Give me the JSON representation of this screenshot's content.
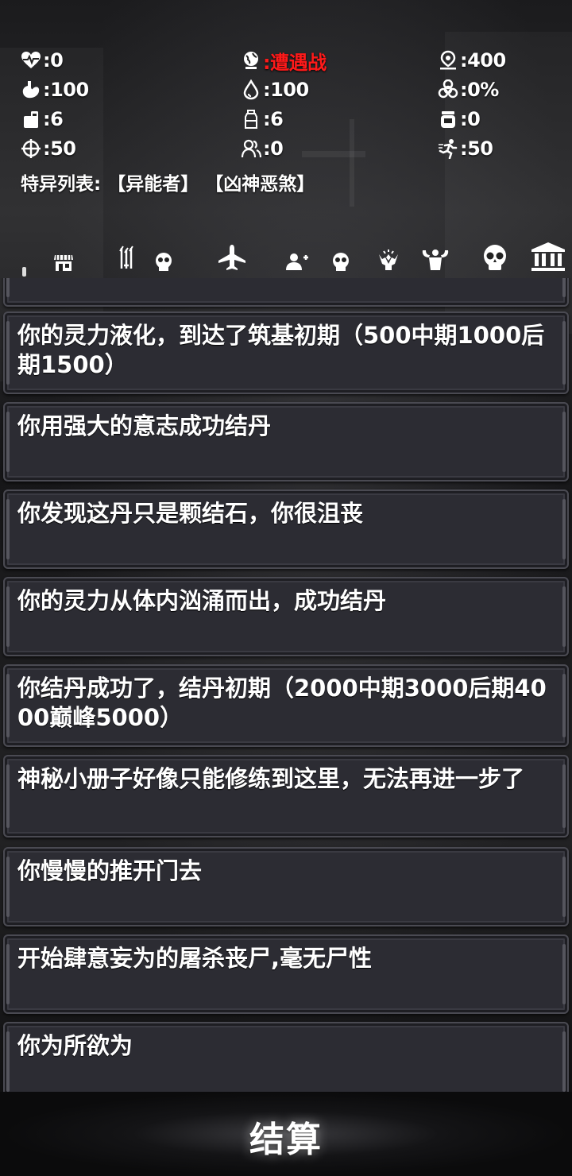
{
  "stats": {
    "health": ":0",
    "mode": ":遭遇战",
    "distance": ":400",
    "hunger": ":100",
    "water": ":100",
    "infection": ":0%",
    "food": ":6",
    "drink": ":6",
    "supplies": ":0",
    "accuracy": ":50",
    "companions": ":0",
    "agility": ":50"
  },
  "traits": {
    "label": "特异列表:",
    "items": [
      "【异能者】",
      "【凶神恶煞】"
    ]
  },
  "colors": {
    "mode_red": "#ff1a1a",
    "card_bg": "#2c2c33"
  },
  "toolbar": {
    "icons": [
      "shop-icon",
      "weapon-skull-icon",
      "plane-icon",
      "add-skull-icon",
      "relic-icon",
      "muscle-icon",
      "big-skull-icon",
      "bank-icon"
    ]
  },
  "log": [
    "",
    "你的灵力液化，到达了筑基初期（500中期1000后期1500）",
    "你用强大的意志成功结丹",
    "你发现这丹只是颗结石，你很沮丧",
    "你的灵力从体内汹涌而出，成功结丹",
    "你结丹成功了，结丹初期（2000中期3000后期4000巅峰5000）",
    "神秘小册子好像只能修练到这里，无法再进一步了",
    "你慢慢的推开门去",
    "开始肆意妄为的屠杀丧尸,毫无尸性",
    "你为所欲为"
  ],
  "settle_label": "结算"
}
